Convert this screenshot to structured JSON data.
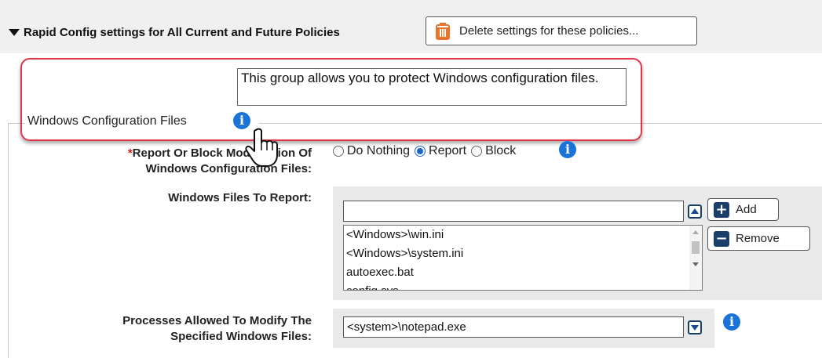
{
  "header": {
    "title": "Rapid Config settings for All Current and Future Policies",
    "delete_button_label": "Delete settings for these policies..."
  },
  "group": {
    "description": "This group allows you to protect Windows configuration files.",
    "legend": "Windows Configuration Files"
  },
  "fields": {
    "report_or_block": {
      "required_marker": "*",
      "label_line1": "Report Or Block Modification Of",
      "label_line2": "Windows Configuration Files:",
      "options": [
        "Do Nothing",
        "Report",
        "Block"
      ],
      "selected": "Report"
    },
    "files_to_report": {
      "label": "Windows Files To Report:",
      "input_value": "",
      "add_label": "Add",
      "remove_label": "Remove",
      "items": [
        "<Windows>\\win.ini",
        "<Windows>\\system.ini",
        "autoexec.bat",
        "config.sys"
      ]
    },
    "processes_allowed": {
      "label_line1": "Processes Allowed To Modify The",
      "label_line2": "Specified Windows Files:",
      "value": "<system>\\notepad.exe"
    }
  },
  "colors": {
    "info_blue": "#1a73d9",
    "highlight_red": "#e0354a",
    "button_navy": "#1b3f6b",
    "trash_orange": "#e8742a"
  },
  "icons": [
    "caret-down-icon",
    "trash-icon",
    "info-icon",
    "hand-pointer-icon",
    "plus-icon",
    "minus-icon",
    "arrow-up-icon",
    "arrow-down-icon"
  ]
}
